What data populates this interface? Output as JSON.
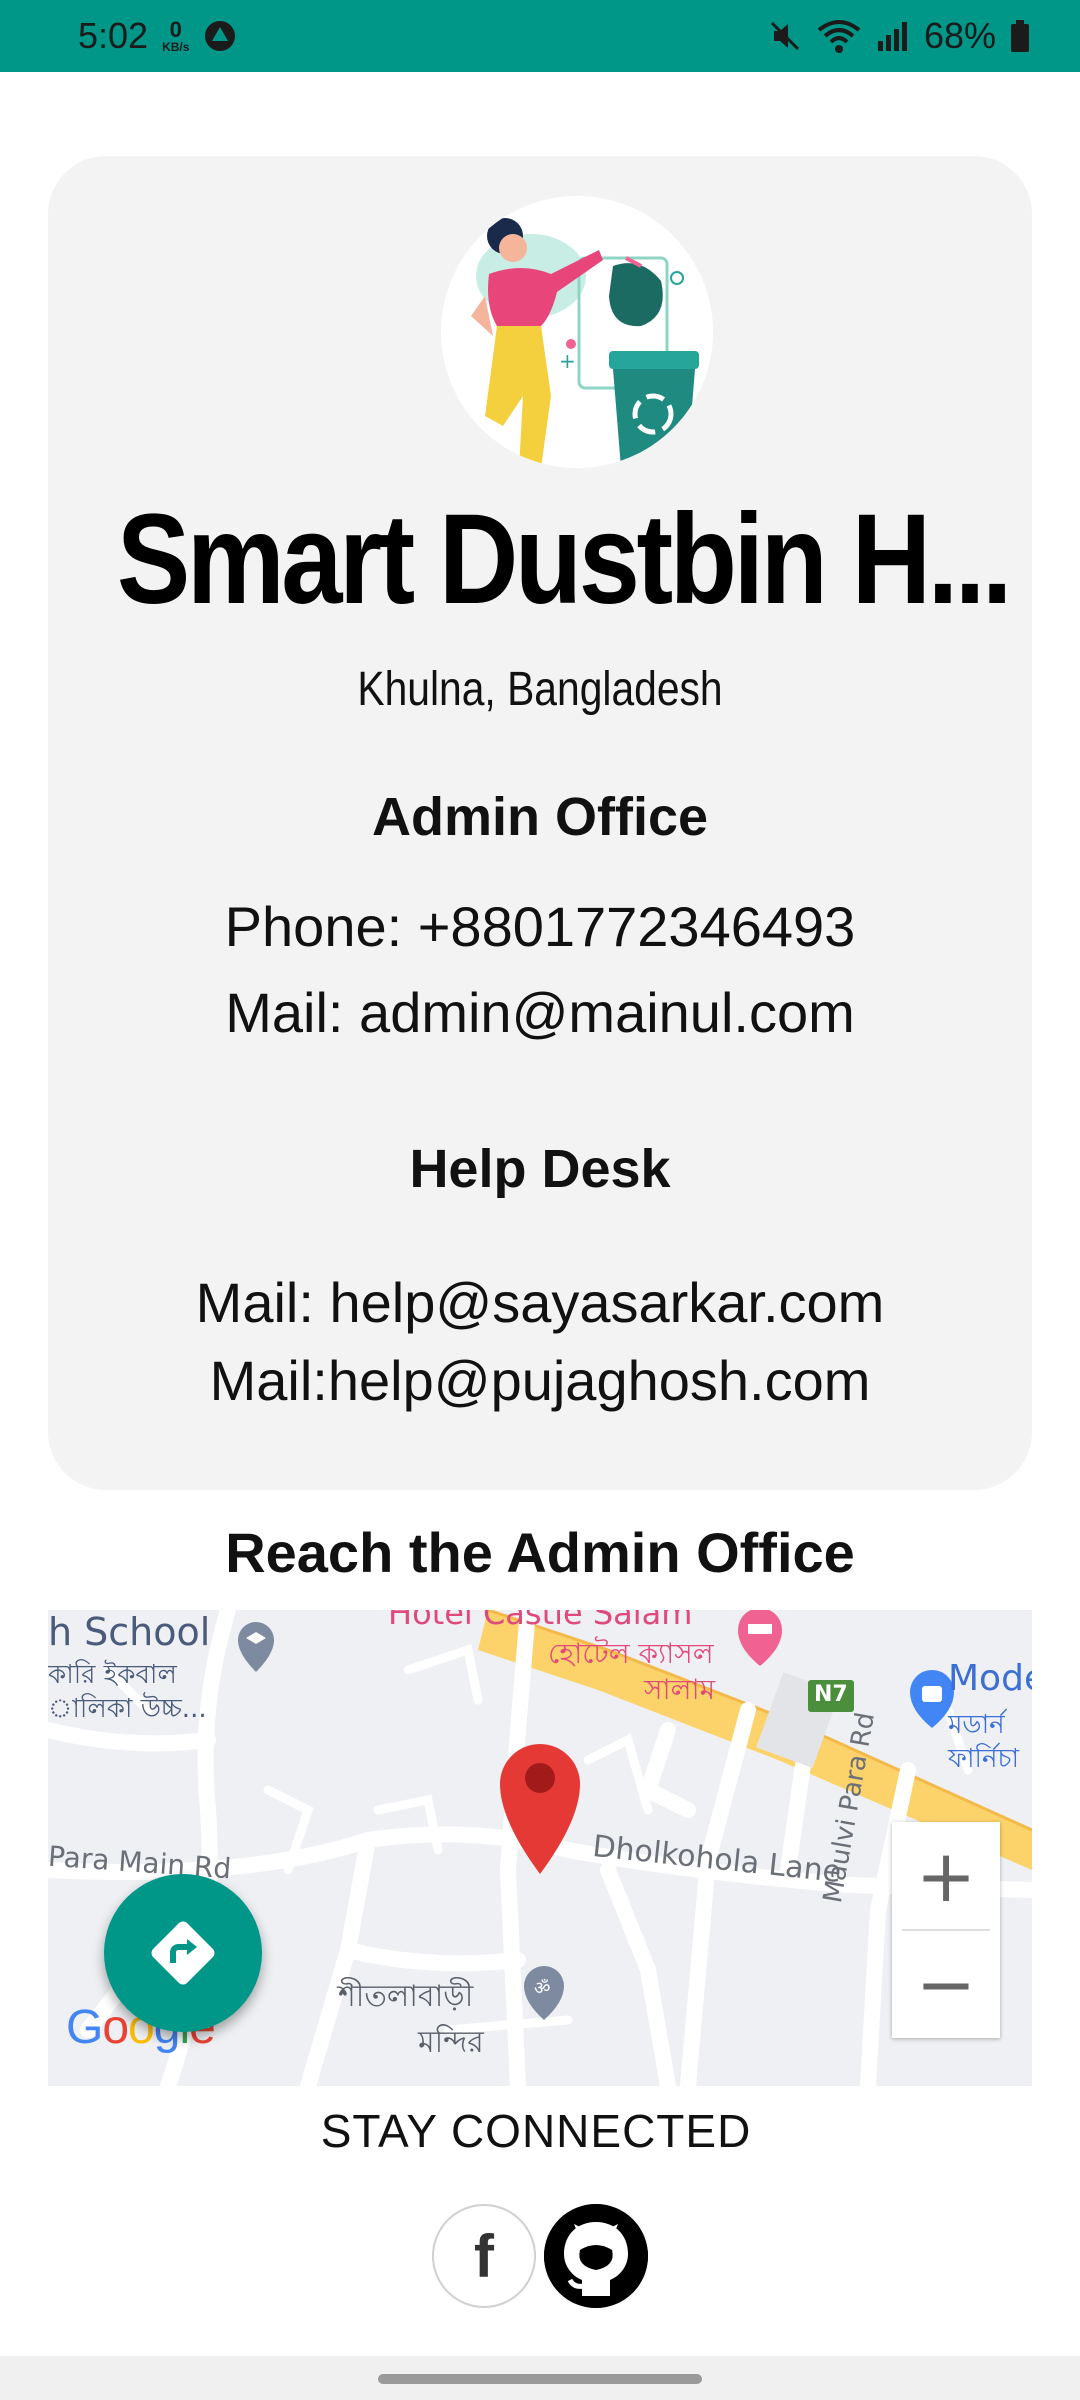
{
  "status_bar": {
    "time": "5:02",
    "net_speed_value": "0",
    "net_speed_unit": "KB/s",
    "battery": "68%"
  },
  "card": {
    "title": "Smart Dustbin H...",
    "location": "Khulna, Bangladesh",
    "admin_heading": "Admin Office",
    "admin_phone": "Phone: +8801772346493",
    "admin_mail": "Mail: admin@mainul.com",
    "help_heading": "Help Desk",
    "help_mail_1": "Mail: help@sayasarkar.com",
    "help_mail_2": "Mail:help@pujaghosh.com"
  },
  "reach_title": "Reach the Admin Office",
  "map": {
    "labels": {
      "school": "h School",
      "school_bn_1": "কারি ইকবাল",
      "school_bn_2": "ালিকা উচ্চ...",
      "hotel_en": "Hotel Castle Salam",
      "hotel_bn_1": "হোটেল ক্যাসল",
      "hotel_bn_2": "সালাম",
      "road_n7": "N7",
      "modern": "Mode",
      "modern_bn_1": "মডার্ন",
      "modern_bn_2": "ফার্নিচা",
      "para_main": "Para Main Rd",
      "dholkohola": "Dholkohola Lane",
      "maulvi": "Maulvi Para Rd",
      "temple_bn_1": "শীতলাবাড়ী",
      "temple_bn_2": "মন্দির",
      "google": "Google"
    },
    "zoom_in": "+",
    "zoom_out": "−"
  },
  "stay_connected": "STAY CONNECTED",
  "social": {
    "facebook": "f",
    "github": "github-icon"
  },
  "colors": {
    "teal": "#009688",
    "card_bg": "#f3f3f3",
    "pin_red": "#e53935"
  }
}
